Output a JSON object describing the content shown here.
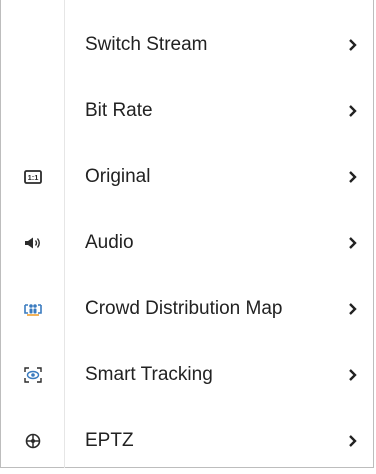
{
  "menu": {
    "items": [
      {
        "label": "Switch Stream",
        "icon": "none"
      },
      {
        "label": "Bit Rate",
        "icon": "none"
      },
      {
        "label": "Original",
        "icon": "aspect-1-1-icon",
        "icon_text": "1:1"
      },
      {
        "label": "Audio",
        "icon": "speaker-icon"
      },
      {
        "label": "Crowd Distribution Map",
        "icon": "crowd-map-icon"
      },
      {
        "label": "Smart Tracking",
        "icon": "tracking-eye-icon"
      },
      {
        "label": "EPTZ",
        "icon": "crosshair-globe-icon"
      }
    ],
    "colors": {
      "text": "#222222",
      "icon_dark": "#2b2b2b",
      "icon_accent": "#3a7bbf",
      "border": "#bdbdbd"
    }
  }
}
